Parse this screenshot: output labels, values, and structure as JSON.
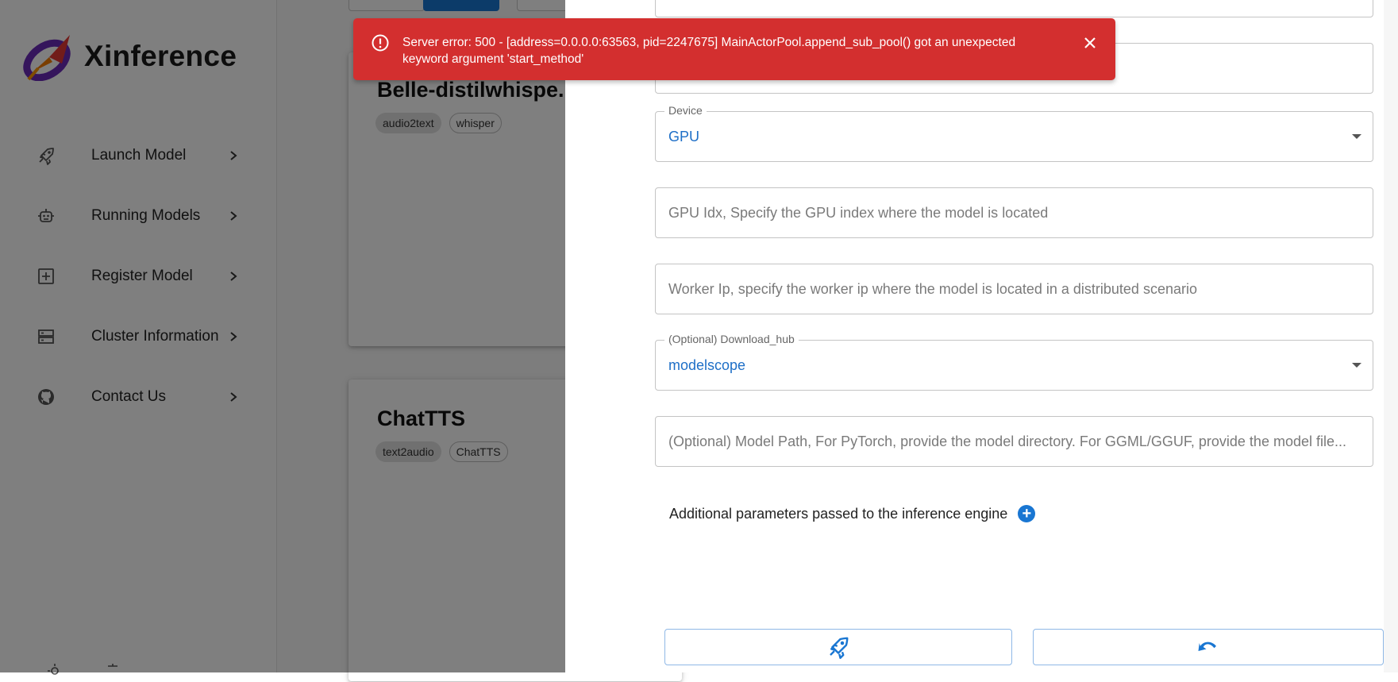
{
  "app": {
    "brand_name": "Xinference",
    "nav": [
      {
        "label": "Launch Model",
        "icon": "rocket-icon"
      },
      {
        "label": "Running Models",
        "icon": "robot-icon"
      },
      {
        "label": "Register Model",
        "icon": "add-box-icon"
      },
      {
        "label": "Cluster Information",
        "icon": "storage-icon"
      },
      {
        "label": "Contact Us",
        "icon": "github-icon"
      }
    ],
    "cards": [
      {
        "title": "Belle-distilwhispe...",
        "tags": [
          "audio2text",
          "whisper"
        ]
      },
      {
        "title": "ChatTTS",
        "tags": [
          "text2audio",
          "ChatTTS"
        ]
      }
    ]
  },
  "drawer": {
    "device": {
      "label": "Device",
      "value": "GPU"
    },
    "gpu_idx": {
      "placeholder": "GPU Idx, Specify the GPU index where the model is located"
    },
    "worker_ip": {
      "placeholder": "Worker Ip, specify the worker ip where the model is located in a distributed scenario"
    },
    "download_hub": {
      "label": "(Optional) Download_hub",
      "value": "modelscope"
    },
    "model_path": {
      "placeholder": "(Optional) Model Path, For PyTorch, provide the model directory. For GGML/GGUF, provide the model file..."
    },
    "additional_params_label": "Additional parameters passed to the inference engine",
    "launch_icon": "rocket-icon",
    "reset_icon": "undo-icon"
  },
  "toast": {
    "message": "Server error: 500 - [address=0.0.0.0:63563, pid=2247675] MainActorPool.append_sub_pool() got an unexpected keyword argument 'start_method'",
    "severity": "error",
    "color": "#d32f2f"
  },
  "colors": {
    "accent": "#1976d2",
    "error": "#d32f2f"
  }
}
